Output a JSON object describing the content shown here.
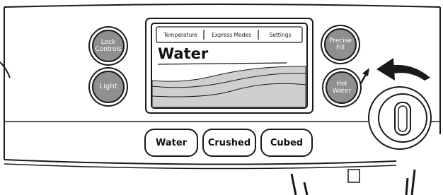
{
  "left_buttons": [
    {
      "label_line1": "Lock",
      "label_line2": "Controls"
    },
    {
      "label_line1": "Light",
      "label_line2": ""
    }
  ],
  "right_buttons": [
    {
      "label_line1": "Precise",
      "label_line2": "Fill"
    },
    {
      "label_line1": "Hot",
      "label_line2": "Water"
    }
  ],
  "display": {
    "tabs": [
      "Temperature",
      "Express Modes",
      "Settings"
    ],
    "mode_title": "Water"
  },
  "dispense_buttons": [
    "Water",
    "Crushed",
    "Cubed"
  ],
  "icons": {
    "rotate": "curved-arrow-icon",
    "knob": "dial-knob-icon"
  },
  "colors": {
    "button_fill": "#8f8f8f",
    "outline": "#1a1a1a",
    "lcd_wave": "#cfcfcf"
  }
}
